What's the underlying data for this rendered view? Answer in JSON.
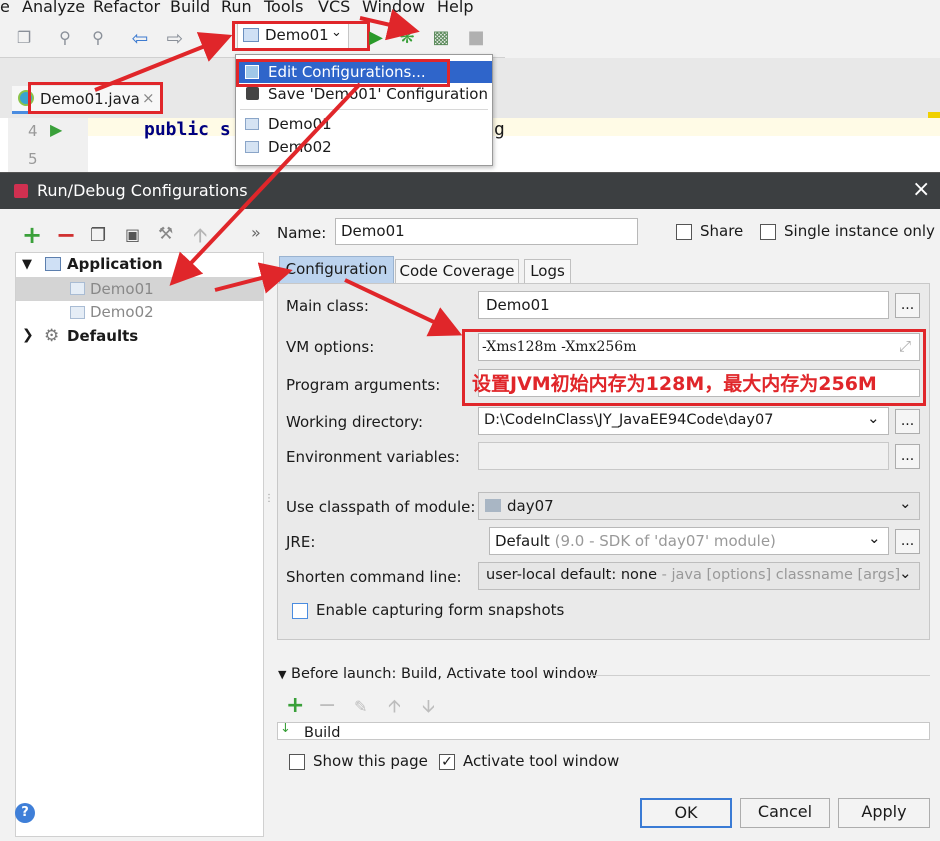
{
  "menubar": {
    "items": [
      "e",
      "Analyze",
      "Refactor",
      "Build",
      "Run",
      "Tools",
      "VCS",
      "Window",
      "Help"
    ]
  },
  "toolbar": {
    "run_config": "Demo01"
  },
  "editor_tab": {
    "label": "Demo01.java",
    "close": "×"
  },
  "editor": {
    "line4": "4",
    "line5": "5",
    "code": "public s",
    "code_tail": "g"
  },
  "run_dropdown": {
    "items": [
      "Edit Configurations...",
      "Save 'Demo01' Configuration",
      "Demo01",
      "Demo02"
    ]
  },
  "dialog": {
    "title": "Run/Debug Configurations",
    "close": "×",
    "toolbar_more": "»",
    "tree": {
      "application": "Application",
      "demo01": "Demo01",
      "demo02": "Demo02",
      "defaults": "Defaults"
    },
    "name_label": "Name:",
    "name_value": "Demo01",
    "share_label": "Share",
    "single_instance_label": "Single instance only",
    "tabs": [
      "Configuration",
      "Code Coverage",
      "Logs"
    ],
    "main_class_label": "Main class:",
    "main_class_value": "Demo01",
    "vm_options_label": "VM options:",
    "vm_options_value": "-Xms128m -Xmx256m",
    "program_args_label": "Program arguments:",
    "annotation": "设置JVM初始内存为128M，最大内存为256M",
    "working_dir_label": "Working directory:",
    "working_dir_value": "D:\\CodeInClass\\JY_JavaEE94Code\\day07",
    "env_vars_label": "Environment variables:",
    "classpath_label": "Use classpath of module:",
    "classpath_value": "day07",
    "jre_label": "JRE:",
    "jre_value": "Default",
    "jre_hint": "(9.0 - SDK of 'day07' module)",
    "shorten_label": "Shorten command line:",
    "shorten_value": "user-local default: none",
    "shorten_hint": "- java [options] classname [args]",
    "capture_label": "Enable capturing form snapshots",
    "before_launch": "Before launch: Build, Activate tool window",
    "build_item": "Build",
    "show_page_label": "Show this page",
    "activate_label": "Activate tool window",
    "ok": "OK",
    "cancel": "Cancel",
    "apply": "Apply",
    "help": "?",
    "ellipsis": "..."
  },
  "colors": {
    "annotation_red": "#e0262a",
    "titlebar": "#3c3f41",
    "selection_blue": "#2f65ca",
    "ok_border": "#3a7bd5"
  }
}
